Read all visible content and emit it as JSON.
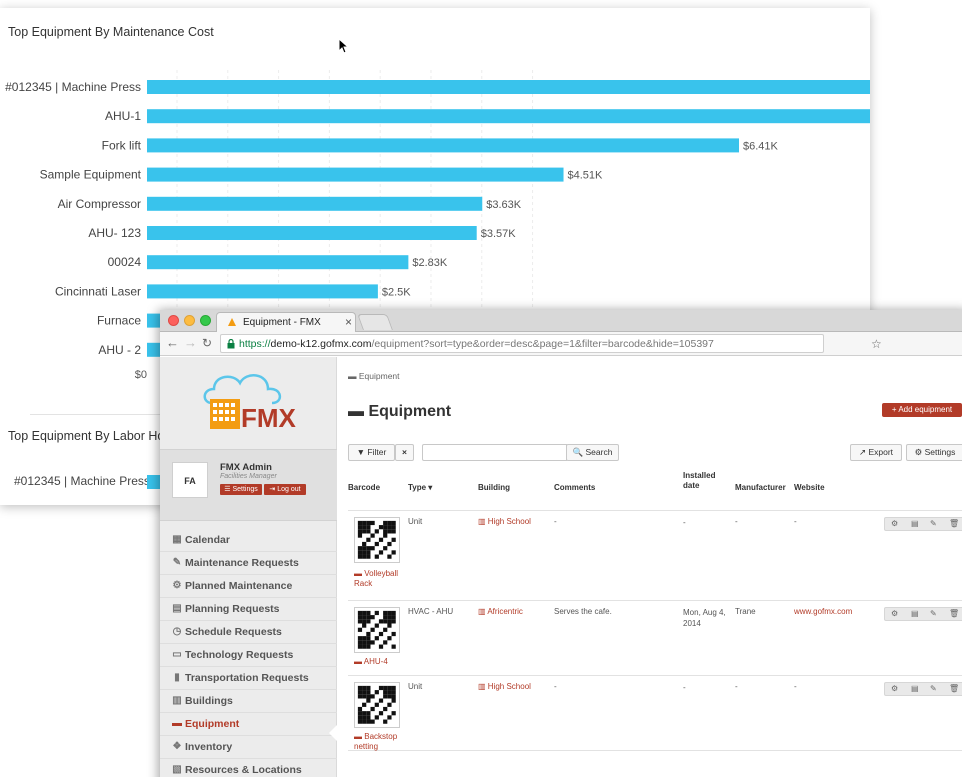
{
  "chart1": {
    "title": "Top Equipment By Maintenance Cost",
    "x_zero_label": "$0"
  },
  "chart_data": [
    {
      "type": "bar",
      "orientation": "horizontal",
      "title": "Top Equipment By Maintenance Cost",
      "categories": [
        "#012345 | Machine Press",
        "AHU-1",
        "Fork lift",
        "Sample Equipment",
        "Air Compressor",
        "AHU- 123",
        "00024",
        "Cincinnati Laser",
        "Furnace",
        "AHU - 2"
      ],
      "values": [
        12.0,
        12.0,
        6.41,
        4.51,
        3.63,
        3.57,
        2.83,
        2.5,
        2.1,
        1.0
      ],
      "value_labels": [
        "",
        "",
        "$6.41K",
        "$4.51K",
        "$3.63K",
        "$3.57K",
        "$2.83K",
        "$2.5K",
        "",
        ""
      ],
      "unit": "$K",
      "xlim": [
        0,
        8.0
      ],
      "grid": true,
      "color": "#39c3ec"
    }
  ],
  "chart2": {
    "title": "Top Equipment By Labor Ho",
    "row_label": "#012345 | Machine Press"
  },
  "browser": {
    "tab_title": "Equipment - FMX",
    "tab_close": "×",
    "url_secure": "https://",
    "url_host": "demo-k12.gofmx.com",
    "url_path": "/equipment?sort=type&order=desc&page=1&filter=barcode&hide=105397",
    "star": "☆"
  },
  "sidebar": {
    "logo_text": "FMX",
    "user_name": "FMX Admin",
    "user_role": "Facilities Manager",
    "avatar": "FA",
    "settings_label": "☰ Settings",
    "logout_label": "⇥ Log out",
    "items": [
      {
        "label": "Calendar",
        "icon": "calendar-icon",
        "glyph": "▦"
      },
      {
        "label": "Maintenance Requests",
        "icon": "wrench-icon",
        "glyph": "✎"
      },
      {
        "label": "Planned Maintenance",
        "icon": "gears-icon",
        "glyph": "⚙"
      },
      {
        "label": "Planning Requests",
        "icon": "clipboard-icon",
        "glyph": "▤"
      },
      {
        "label": "Schedule Requests",
        "icon": "clock-icon",
        "glyph": "◷"
      },
      {
        "label": "Technology Requests",
        "icon": "laptop-icon",
        "glyph": "▭"
      },
      {
        "label": "Transportation Requests",
        "icon": "bus-icon",
        "glyph": "▮"
      },
      {
        "label": "Buildings",
        "icon": "building-icon",
        "glyph": "▥"
      },
      {
        "label": "Equipment",
        "icon": "briefcase-icon",
        "glyph": "▬"
      },
      {
        "label": "Inventory",
        "icon": "cubes-icon",
        "glyph": "❖"
      },
      {
        "label": "Resources & Locations",
        "icon": "map-icon",
        "glyph": "▧"
      }
    ],
    "active_item": "Equipment"
  },
  "main": {
    "breadcrumb": "Equipment",
    "title": "Equipment",
    "add_button": "+ Add equipment",
    "filter_button": "▼ Filter",
    "clear_button": "×",
    "search_placeholder": "",
    "search_button": "🔍 Search",
    "export_button": "↗ Export",
    "settings_button": "⚙ Settings",
    "columns": [
      "Barcode",
      "Type ▾",
      "Building",
      "Comments",
      "Installed date",
      "Manufacturer",
      "Website"
    ],
    "rows": [
      {
        "equipment": "Volleyball Rack",
        "type": "Unit",
        "building": "High School",
        "comments": "-",
        "installed": "-",
        "manufacturer": "-",
        "website": "-"
      },
      {
        "equipment": "AHU-4",
        "type": "HVAC - AHU",
        "building": "Africentric",
        "comments": "Serves the cafe.",
        "installed": "Mon, Aug 4, 2014",
        "manufacturer": "Trane",
        "website": "www.gofmx.com"
      },
      {
        "equipment": "Backstop netting",
        "type": "Unit",
        "building": "High School",
        "comments": "-",
        "installed": "-",
        "manufacturer": "-",
        "website": "-"
      }
    ]
  }
}
